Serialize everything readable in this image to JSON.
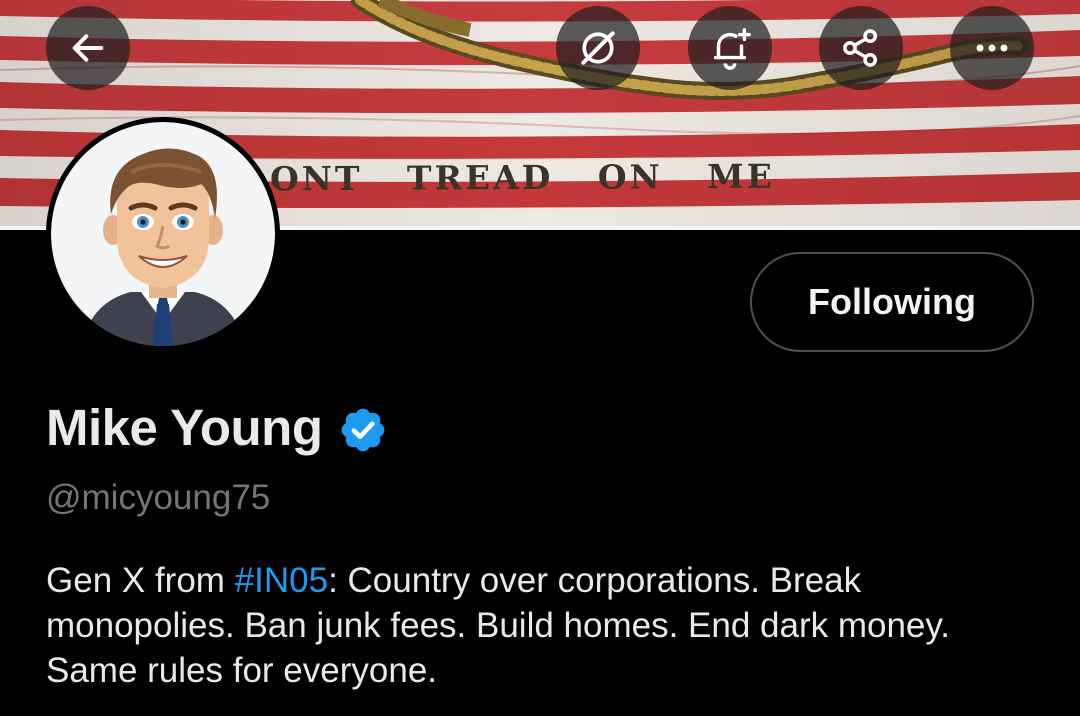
{
  "banner": {
    "motto": "ONT TREAD ON ME"
  },
  "header": {
    "back_icon": "arrow-left-icon",
    "grok_icon": "grok-slash-icon",
    "notify_icon": "bell-plus-icon",
    "share_icon": "share-icon",
    "more_icon": "more-horizontal-icon"
  },
  "profile": {
    "display_name": "Mike Young",
    "verified_icon": "verified-badge-icon",
    "handle": "@micyoung75",
    "follow_button_label": "Following",
    "bio": {
      "before": "Gen X from ",
      "hashtag": "#IN05",
      "after": ": Country over corporations. Break monopolies. Ban junk fees. Build homes. End dark money. Same rules for everyone."
    }
  },
  "colors": {
    "background": "#000000",
    "primary_text": "#e7e9ea",
    "secondary_text": "#71767b",
    "link": "#1d9bf0",
    "verified": "#1d9bf0",
    "button_border": "#4d5156"
  }
}
